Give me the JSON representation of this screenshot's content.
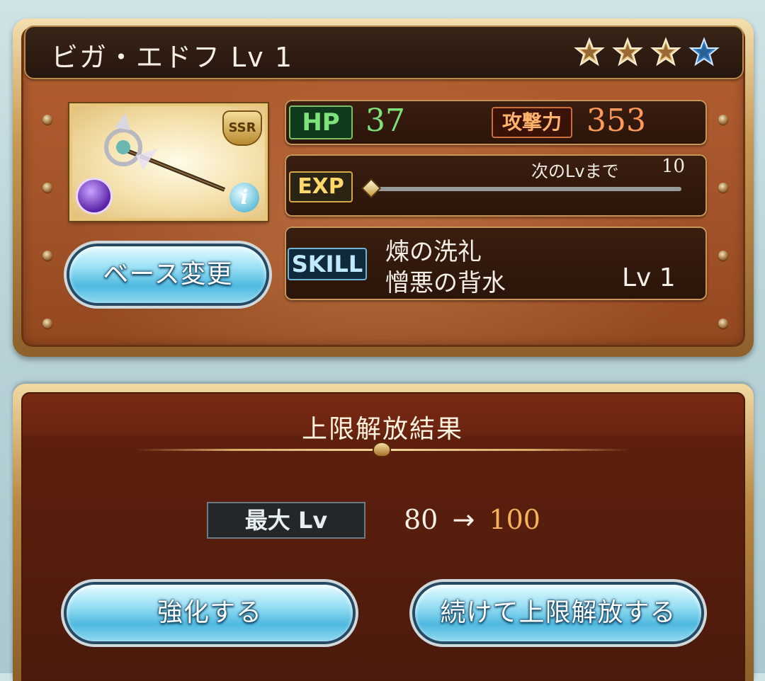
{
  "header": {
    "title": "ビガ・エドフ Lv 1",
    "stars_total": 4,
    "stars_filled": 3
  },
  "weapon": {
    "rarity": "SSR",
    "element_icon": "dark-element-icon",
    "info_icon": "info-icon"
  },
  "buttons": {
    "change_base": "ベース変更",
    "enhance": "強化する",
    "continue_uncap": "続けて上限解放する"
  },
  "stats": {
    "hp_label": "HP",
    "hp_value": "37",
    "atk_label": "攻撃力",
    "atk_value": "353",
    "exp_label": "EXP",
    "exp_next_label": "次のLvまで",
    "exp_next_value": "10",
    "exp_progress": 0.0
  },
  "skill": {
    "label": "SKILL",
    "name_1": "煉の洗礼",
    "name_2": "憎悪の背水",
    "level": "Lv 1"
  },
  "result": {
    "title": "上限解放結果",
    "max_lv_label": "最大 Lv",
    "max_lv_from": "80",
    "arrow": "→",
    "max_lv_to": "100"
  },
  "colors": {
    "hp_value": "#7ee27a",
    "atk_value": "#ff9a5a",
    "new_max": "#f5b35b"
  }
}
